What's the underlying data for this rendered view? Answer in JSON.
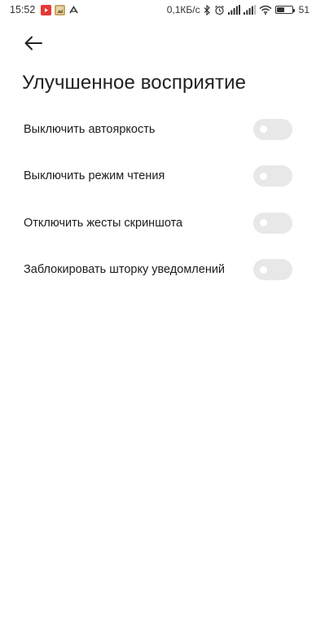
{
  "status_bar": {
    "time": "15:52",
    "network_speed": "0,1КБ/с",
    "battery_percent": "51",
    "battery_level": 0.51,
    "icons": [
      "youtube-icon",
      "gallery-icon",
      "app-a-icon",
      "bluetooth-icon",
      "alarm-icon",
      "signal-icon",
      "signal-icon",
      "wifi-icon",
      "battery-icon"
    ],
    "colors": {
      "youtube": "#e53935",
      "gallery": "#c9a46a"
    }
  },
  "header": {
    "back_icon": "arrow-left-icon",
    "title": "Улучшенное восприятие"
  },
  "settings": {
    "items": [
      {
        "label": "Выключить автояркость",
        "enabled": false
      },
      {
        "label": "Выключить режим чтения",
        "enabled": false
      },
      {
        "label": "Отключить жесты скриншота",
        "enabled": false
      },
      {
        "label": "Заблокировать шторку уведомлений",
        "enabled": false
      }
    ]
  },
  "colors": {
    "toggle_off_track": "#e8e8e8",
    "toggle_knob": "#ffffff",
    "text_primary": "#1c1c1c",
    "background": "#ffffff"
  }
}
